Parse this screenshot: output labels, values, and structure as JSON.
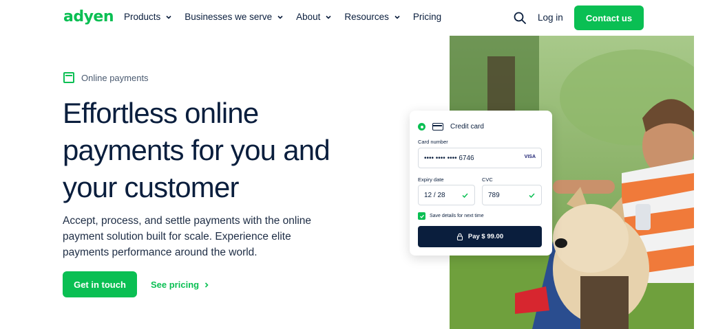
{
  "brand": {
    "logo": "adyen",
    "accent": "#0abf53",
    "navy": "#0a1e3d"
  },
  "nav": {
    "items": [
      {
        "label": "Products",
        "has_dropdown": true
      },
      {
        "label": "Businesses we serve",
        "has_dropdown": true
      },
      {
        "label": "About",
        "has_dropdown": true
      },
      {
        "label": "Resources",
        "has_dropdown": true
      },
      {
        "label": "Pricing",
        "has_dropdown": false
      }
    ],
    "search_icon": "search-icon",
    "login": "Log in",
    "contact": "Contact us"
  },
  "hero": {
    "eyebrow": "Online payments",
    "headline": "Effortless online payments for you and your customer",
    "subtext": "Accept, process, and settle payments with the online payment solution built for scale. Experience elite payments performance around the world.",
    "primary_cta": "Get in touch",
    "secondary_cta": "See pricing"
  },
  "payment_card": {
    "method": "Credit card",
    "card_number_label": "Card number",
    "card_number_value": "•••• •••• •••• 6746",
    "card_brand": "VISA",
    "expiry_label": "Expiry date",
    "expiry_value": "12 / 28",
    "cvc_label": "CVC",
    "cvc_value": "789",
    "save_label": "Save details for next time",
    "pay_label": "Pay $ 99.00"
  }
}
